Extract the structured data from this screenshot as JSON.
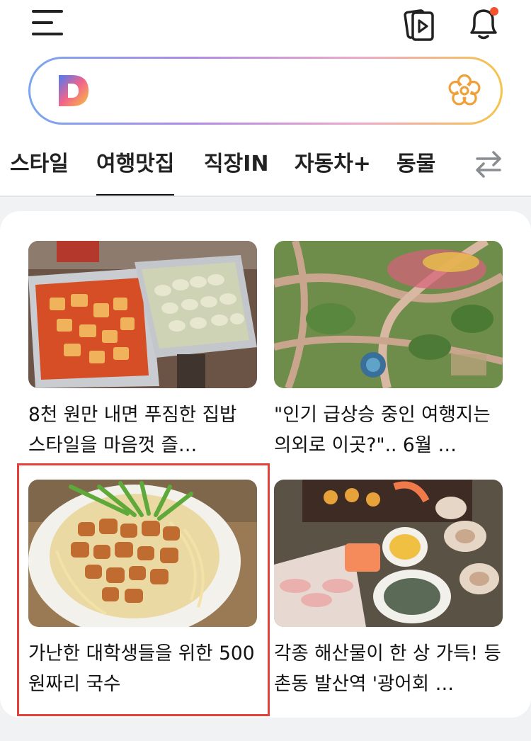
{
  "header": {
    "menu_icon": "hamburger-menu-icon",
    "video_icon": "video-playlist-icon",
    "bell_icon": "notification-bell-icon",
    "notification_dot_color": "#f2532e"
  },
  "search": {
    "logo": "daum-logo",
    "placeholder": "",
    "value": "",
    "right_icon": "flower-icon",
    "accent_color": "#f0a03a"
  },
  "tabs": [
    {
      "label": "스타일"
    },
    {
      "label": "여행맛집",
      "active": true
    },
    {
      "label": "직장IN"
    },
    {
      "label": "자동차+"
    },
    {
      "label": "동물"
    }
  ],
  "tabs_swap_icon": "swap-arrows-icon",
  "cards": [
    {
      "title": "8천 원만 내면 푸짐한 집밥 스타일을 마음껏 즐…",
      "image": "buffet-trays-photo"
    },
    {
      "title": "\"인기 급상승 중인 여행지는 의외로 이곳?\".. 6월 …",
      "image": "aerial-garden-photo"
    },
    {
      "title": "가난한 대학생들을 위한 500원짜리 국수",
      "image": "noodle-bowl-photo",
      "highlighted": true
    },
    {
      "title": "각종 해산물이 한 상 가득! 등촌동 발산역 '광어회 …",
      "image": "seafood-platter-photo"
    }
  ],
  "highlight_color": "#e6403a"
}
